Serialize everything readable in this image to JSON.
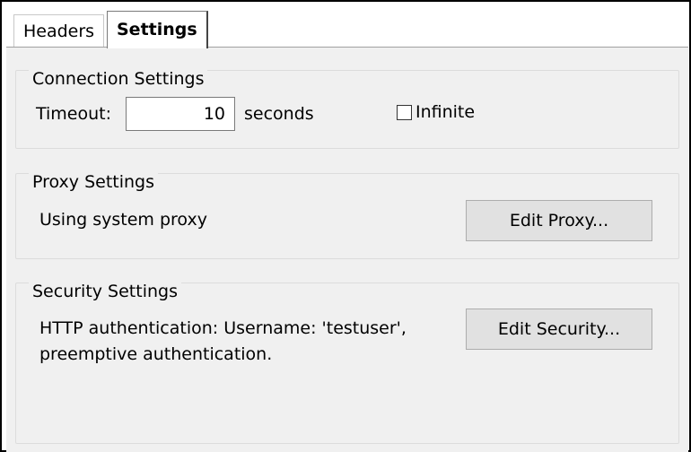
{
  "tabs": [
    {
      "label": "Headers",
      "active": false
    },
    {
      "label": "Settings",
      "active": true
    }
  ],
  "connection": {
    "title": "Connection Settings",
    "timeout_label": "Timeout:",
    "timeout_value": "10",
    "timeout_unit": "seconds",
    "infinite_label": "Infinite",
    "infinite_checked": false
  },
  "proxy": {
    "title": "Proxy Settings",
    "status": "Using system proxy",
    "edit_button": "Edit Proxy..."
  },
  "security": {
    "title": "Security Settings",
    "status_line1": "HTTP authentication: Username: 'testuser',",
    "status_line2": "preemptive authentication.",
    "edit_button": "Edit Security..."
  },
  "colors": {
    "panel_bg": "#f0f0f0",
    "button_bg": "#e1e1e1"
  }
}
